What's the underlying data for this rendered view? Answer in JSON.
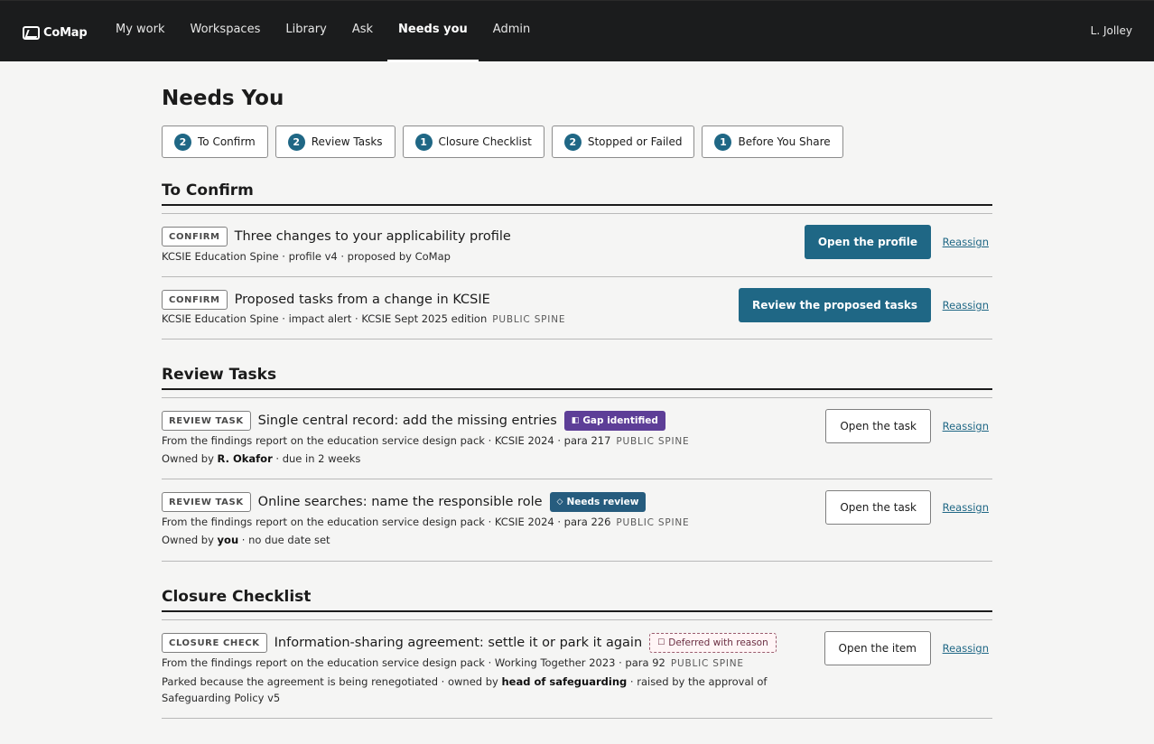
{
  "app": {
    "name": "CoMap",
    "user": "L. Jolley"
  },
  "nav": [
    "My work",
    "Workspaces",
    "Library",
    "Ask",
    "Needs you",
    "Admin"
  ],
  "page": {
    "title": "Needs You"
  },
  "chips": [
    {
      "count": "2",
      "label": "To Confirm"
    },
    {
      "count": "2",
      "label": "Review Tasks"
    },
    {
      "count": "1",
      "label": "Closure Checklist"
    },
    {
      "count": "2",
      "label": "Stopped or Failed"
    },
    {
      "count": "1",
      "label": "Before You Share"
    }
  ],
  "sections": {
    "confirm": {
      "title": "To Confirm",
      "rows": [
        {
          "tag": "CONFIRM",
          "title": "Three changes to your applicability profile",
          "meta": "KCSIE Education Spine · profile v4 · proposed by CoMap",
          "action": "Open the profile",
          "reassign": "Reassign"
        },
        {
          "tag": "CONFIRM",
          "title": "Proposed tasks from a change in KCSIE",
          "meta": "KCSIE Education Spine · impact alert · KCSIE Sept 2025 edition",
          "spine": "PUBLIC SPINE",
          "action": "Review the proposed tasks",
          "reassign": "Reassign"
        }
      ]
    },
    "review": {
      "title": "Review Tasks",
      "rows": [
        {
          "tag": "REVIEW TASK",
          "title": "Single central record: add the missing entries",
          "badge": "Gap identified",
          "meta": "From the findings report on the education service design pack · KCSIE 2024 · para 217",
          "spine": "PUBLIC SPINE",
          "owned_prefix": "Owned by",
          "owner": "R. Okafor",
          "due": "· due in 2 weeks",
          "action": "Open the task",
          "reassign": "Reassign"
        },
        {
          "tag": "REVIEW TASK",
          "title": "Online searches: name the responsible role",
          "badge": "Needs review",
          "meta": "From the findings report on the education service design pack · KCSIE 2024 · para 226",
          "spine": "PUBLIC SPINE",
          "owned_prefix": "Owned by",
          "owner": "you",
          "due": "· no due date set",
          "action": "Open the task",
          "reassign": "Reassign"
        }
      ]
    },
    "closure": {
      "title": "Closure Checklist",
      "rows": [
        {
          "tag": "CLOSURE CHECK",
          "title": "Information-sharing agreement: settle it or park it again",
          "badge": "Deferred with reason",
          "meta": "From the findings report on the education service design pack · Working Together 2023 · para 92",
          "spine": "PUBLIC SPINE",
          "parked_prefix": "Parked because the agreement is being renegotiated · owned by",
          "owner": "head of safeguarding",
          "parked_suffix": "· raised by the approval of Safeguarding Policy v5",
          "action": "Open the item",
          "reassign": "Reassign"
        }
      ]
    }
  },
  "colors": {
    "accent": "#1f6785",
    "gap": "#5d3e97",
    "review": "#265c7e",
    "topbar": "#1b1c1d"
  }
}
